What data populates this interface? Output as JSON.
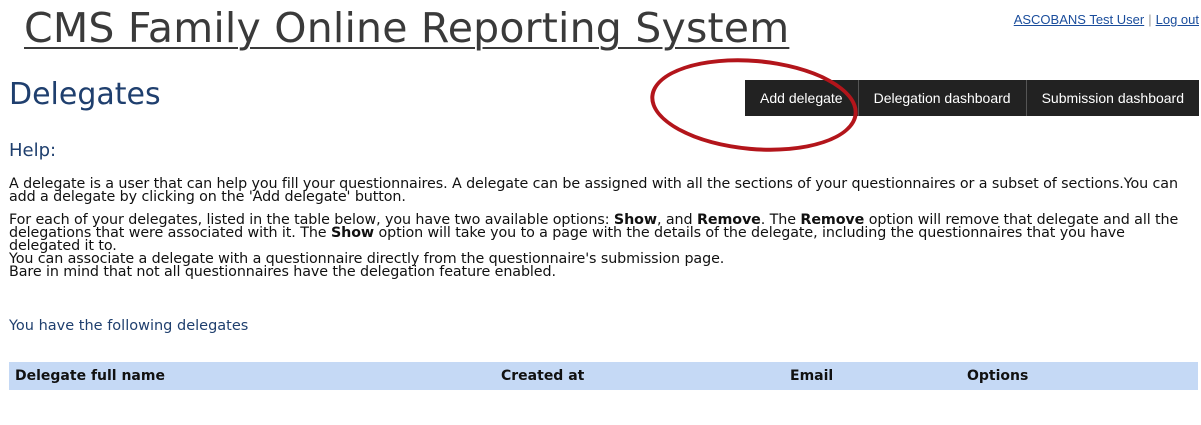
{
  "header": {
    "site_title": "CMS Family Online Reporting System",
    "user_name": "ASCOBANS Test User",
    "separator": "|",
    "logout_label": "Log out"
  },
  "page": {
    "title": "Delegates"
  },
  "toolbar": {
    "add_delegate": "Add delegate",
    "delegation_dashboard": "Delegation dashboard",
    "submission_dashboard": "Submission dashboard"
  },
  "help": {
    "title": "Help:",
    "p1": "A delegate is a user that can help you fill your questionnaires. A delegate can be assigned with all the sections of your questionnaires or a subset of sections.You can add a delegate by clicking on the 'Add delegate' button.",
    "p2_a": "For each of your delegates, listed in the table below, you have two available options: ",
    "p2_show": "Show",
    "p2_b": ", and ",
    "p2_remove": "Remove",
    "p2_c": ". The ",
    "p2_remove2": "Remove",
    "p2_d": " option will remove that delegate and all the delegations that were associated with it. The ",
    "p2_show2": "Show",
    "p2_e": " option will take you to a page with the details of the delegate, including the questionnaires that you have delegated it to.",
    "p3": "You can associate a delegate with a questionnaire directly from the questionnaire's submission page.",
    "p4": "Bare in mind that not all questionnaires have the delegation feature enabled."
  },
  "delegates": {
    "intro": "You have the following delegates",
    "columns": [
      "Delegate full name",
      "Created at",
      "Email",
      "Options"
    ]
  },
  "colors": {
    "title_blue": "#1f3f6e",
    "button_bg": "#222222",
    "table_header_bg": "#c5d9f5",
    "annotation_red": "#b3151b"
  }
}
